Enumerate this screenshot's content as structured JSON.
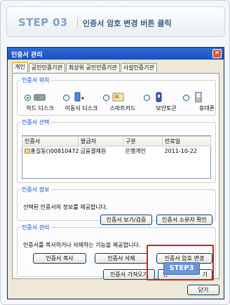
{
  "banner": {
    "step": "STEP 03",
    "title": "인증서 암호 변경 버튼 클릭"
  },
  "window": {
    "title": "인증서 관리",
    "close_glyph": "✕"
  },
  "tabs": [
    "개인",
    "공인인증기관",
    "최상위 공인인증기관",
    "사설인증기관"
  ],
  "location": {
    "legend": "인증서 위치",
    "devices": [
      {
        "label": "하드 디스크",
        "icon": "hard-disk-icon",
        "checked": true
      },
      {
        "label": "이동식 디스크",
        "icon": "usb-drive-icon",
        "checked": false
      },
      {
        "label": "스마트카드",
        "icon": "smartcard-icon",
        "checked": false
      },
      {
        "label": "보안토큰",
        "icon": "security-token-icon",
        "checked": false
      },
      {
        "label": "휴대폰",
        "icon": "mobile-phone-icon",
        "checked": false
      }
    ]
  },
  "selection": {
    "legend": "인증서 선택",
    "columns": [
      "인증서",
      "발급자",
      "구분",
      "만료일"
    ],
    "rows": [
      {
        "cert": "홍길동()00810472...",
        "issuer": "금융결제원",
        "type": "은행개인",
        "expiry": "2011-10-22"
      }
    ]
  },
  "info": {
    "legend": "인증서 정보",
    "description": "선택된 인증서의 정보를 제공합니다.",
    "view_button": "인증서 보기/검증",
    "owner_button": "인증서 소유자 확인"
  },
  "manage": {
    "legend": "인증서 관리",
    "description": "인증서를 복사하거나 삭제하는 기능을 제공합니다.",
    "copy_button": "인증서 복사",
    "delete_button": "인증서 삭제",
    "change_pw_button": "인증서 암호 변경",
    "import_button": "인증서 가져오기",
    "export_button_visible": "인",
    "export_button_tail": "기"
  },
  "footer": {
    "close_button": "닫기"
  },
  "callout": {
    "label": "STEP3",
    "color": "#e01a1a"
  }
}
